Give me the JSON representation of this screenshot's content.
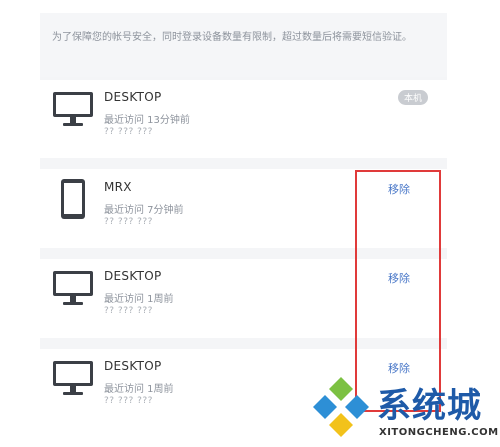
{
  "notice": {
    "text": "为了保障您的帐号安全，同时登录设备数量有限制，超过数量后将需要短信验证。"
  },
  "devices": [
    {
      "type": "desktop",
      "icon": "monitor-icon",
      "name": "DESKTOP",
      "last_visit": "最近访问 13分钟前",
      "ip": "?? ??? ???",
      "badge": "本机"
    },
    {
      "type": "phone",
      "icon": "phone-icon",
      "name": "MRX",
      "last_visit": "最近访问 7分钟前",
      "ip": "?? ??? ???",
      "action": "移除"
    },
    {
      "type": "desktop",
      "icon": "monitor-icon",
      "name": "DESKTOP",
      "last_visit": "最近访问 1周前",
      "ip": "?? ??? ???",
      "action": "移除"
    },
    {
      "type": "desktop",
      "icon": "monitor-icon",
      "name": "DESKTOP",
      "last_visit": "最近访问 1周前",
      "ip": "?? ??? ???",
      "action": "移除"
    }
  ],
  "watermark": {
    "title": "系统城",
    "subtitle": "XITONGCHENG.COM"
  },
  "colors": {
    "link": "#4a78c8",
    "highlight_box": "#e03a3a",
    "watermark_blue": "#1e5aa8"
  }
}
